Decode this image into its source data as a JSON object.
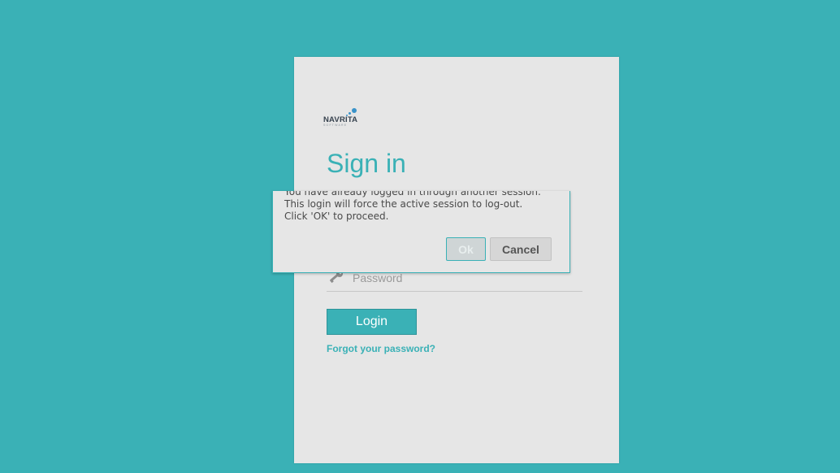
{
  "brand": {
    "logo_text": "NAVRITA",
    "logo_subtext": "SOFTWARE",
    "accent_color": "#3ab1b6"
  },
  "login": {
    "title": "Sign in",
    "password_placeholder": "Password",
    "password_icon": "key-icon",
    "login_label": "Login",
    "forgot_label": "Forgot your password?"
  },
  "dialog": {
    "message_lines": [
      "You have already logged in through another session.",
      "This login will force the active session to log-out.",
      "Click 'OK' to proceed."
    ],
    "ok_label": "Ok",
    "cancel_label": "Cancel"
  }
}
